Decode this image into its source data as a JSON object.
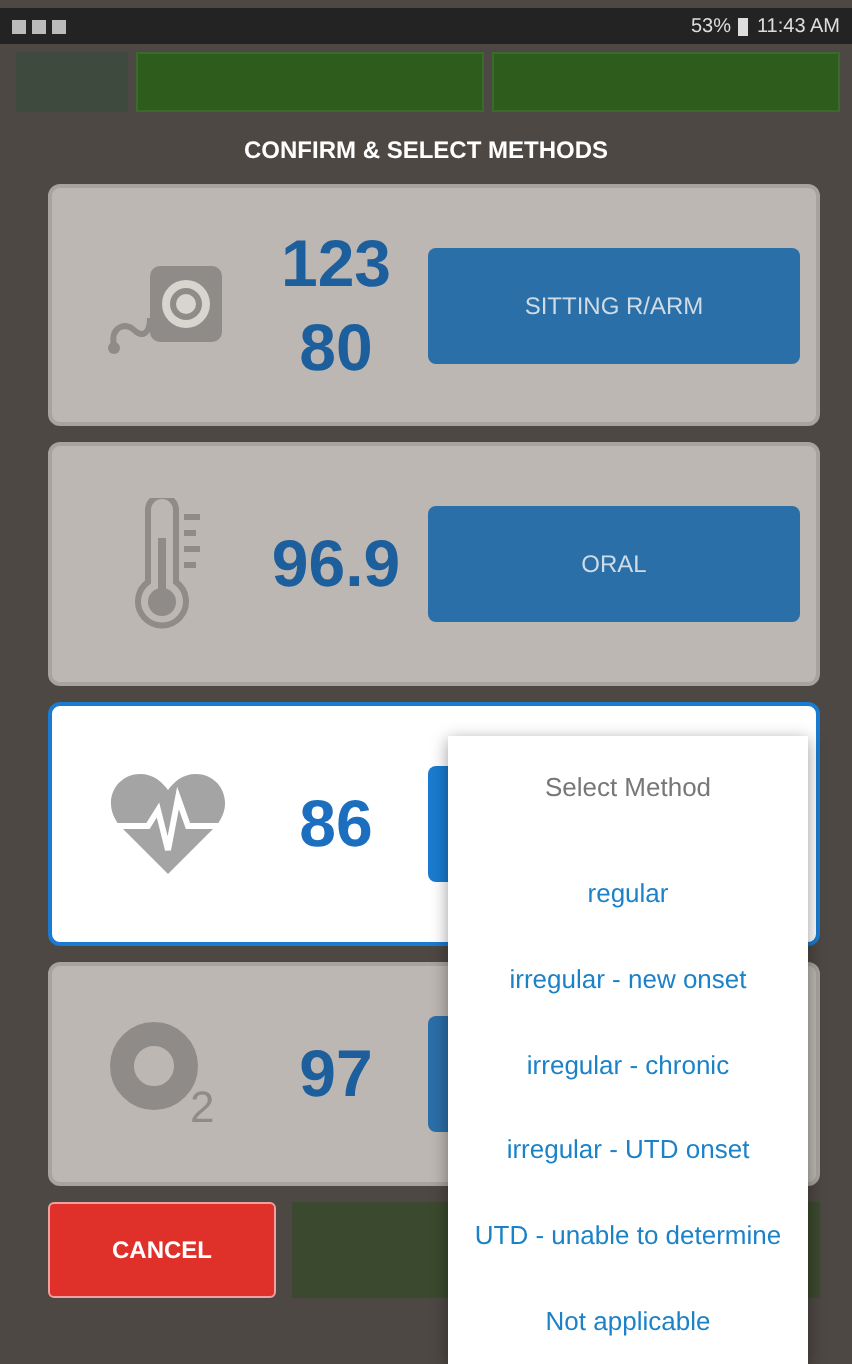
{
  "status_bar": {
    "battery": "53%",
    "time": "11:43 AM"
  },
  "dialog": {
    "title": "CONFIRM & SELECT METHODS",
    "vitals": [
      {
        "kind": "blood-pressure",
        "values": [
          "123",
          "80"
        ],
        "method": "SITTING R/ARM",
        "selected": false
      },
      {
        "kind": "temperature",
        "values": [
          "96.9"
        ],
        "method": "ORAL",
        "selected": false
      },
      {
        "kind": "pulse",
        "values": [
          "86"
        ],
        "selected": true
      },
      {
        "kind": "oxygen",
        "values": [
          "97"
        ],
        "subscript": "2",
        "selected": false
      }
    ],
    "cancel": "CANCEL"
  },
  "method_menu": {
    "title": "Select Method",
    "options": [
      {
        "label": "regular"
      },
      {
        "label": "irregular - new onset"
      },
      {
        "label": "irregular - chronic"
      },
      {
        "label": "irregular - UTD onset"
      },
      {
        "label": "UTD - unable to determine"
      },
      {
        "label": "Not applicable"
      }
    ]
  }
}
